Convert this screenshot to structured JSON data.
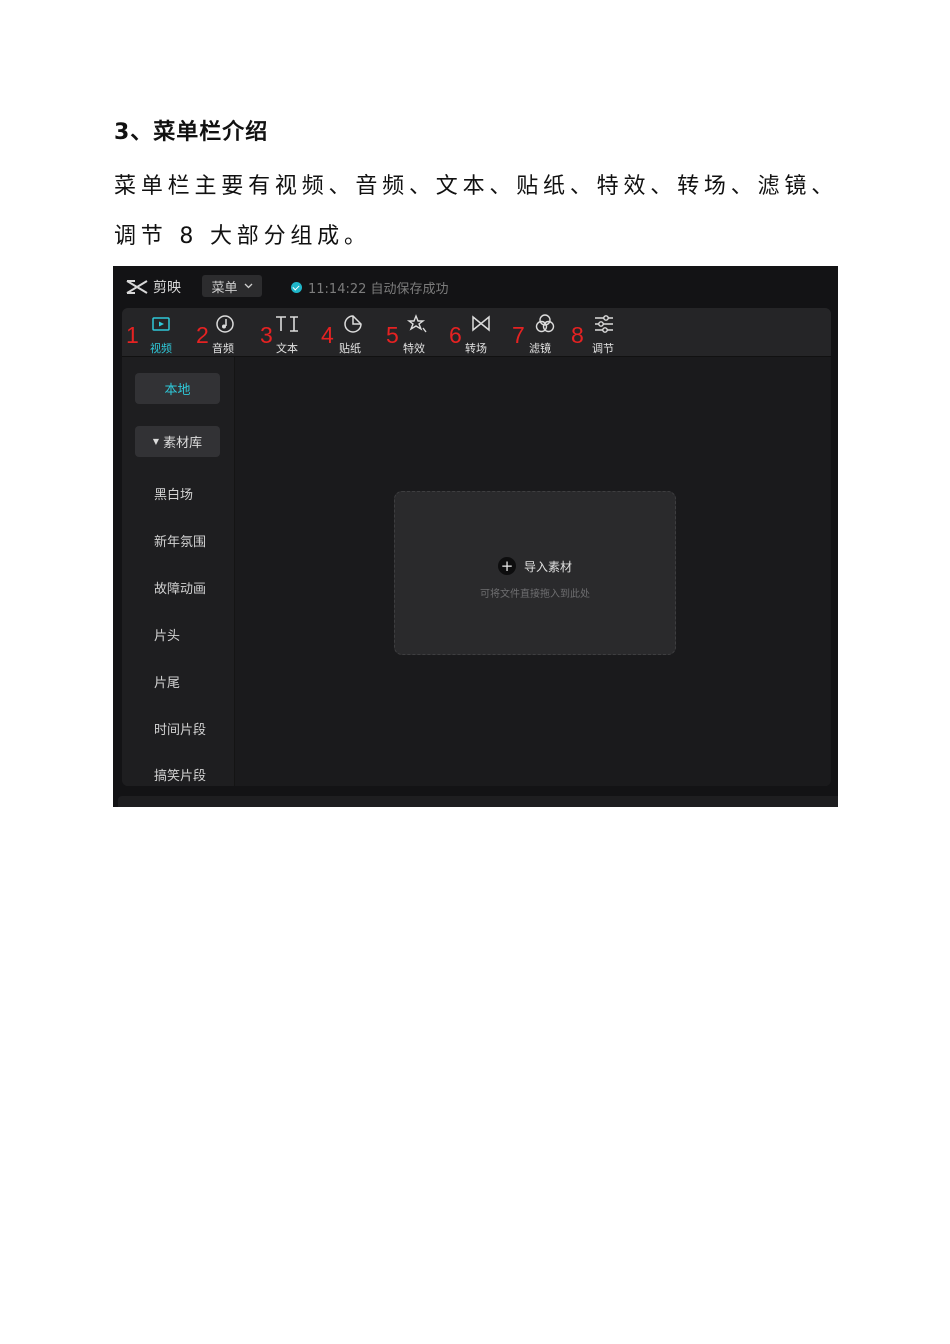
{
  "heading": "3、菜单栏介绍",
  "paragraph": "菜单栏主要有视频、音频、文本、贴纸、特效、转场、滤镜、调节 8 大部分组成。",
  "app": {
    "name": "剪映",
    "menu_label": "菜单",
    "save_status": "11:14:22 自动保存成功",
    "accent_color": "#2fc8d8",
    "annotation_color": "#e52222",
    "toolbar": [
      {
        "num": "1",
        "label": "视频",
        "icon": "video-icon",
        "active": true
      },
      {
        "num": "2",
        "label": "音频",
        "icon": "audio-icon",
        "active": false
      },
      {
        "num": "3",
        "label": "文本",
        "icon": "text-icon",
        "active": false
      },
      {
        "num": "4",
        "label": "贴纸",
        "icon": "sticker-icon",
        "active": false
      },
      {
        "num": "5",
        "label": "特效",
        "icon": "effects-icon",
        "active": false
      },
      {
        "num": "6",
        "label": "转场",
        "icon": "transition-icon",
        "active": false
      },
      {
        "num": "7",
        "label": "滤镜",
        "icon": "filter-icon",
        "active": false
      },
      {
        "num": "8",
        "label": "调节",
        "icon": "adjust-icon",
        "active": false
      }
    ],
    "sidebar": {
      "local": "本地",
      "library": "素材库",
      "items": [
        "黑白场",
        "新年氛围",
        "故障动画",
        "片头",
        "片尾",
        "时间片段",
        "搞笑片段"
      ]
    },
    "dropzone": {
      "import_label": "导入素材",
      "hint": "可将文件直接拖入到此处"
    }
  }
}
